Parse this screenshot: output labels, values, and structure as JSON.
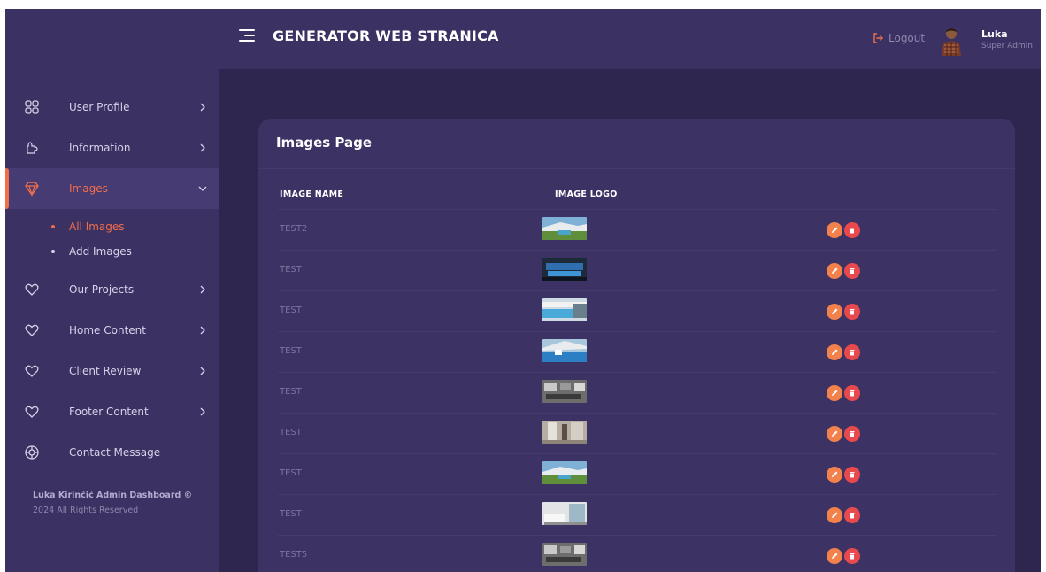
{
  "header": {
    "title": "GENERATOR WEB STRANICA",
    "logout_label": "Logout",
    "user_name": "Luka",
    "user_role": "Super Admin"
  },
  "sidebar": {
    "items": [
      {
        "label": "User Profile",
        "icon": "grid-icon",
        "has_caret": true
      },
      {
        "label": "Information",
        "icon": "puzzle-icon",
        "has_caret": true
      },
      {
        "label": "Images",
        "icon": "diamond-icon",
        "has_caret": true,
        "active": true,
        "expanded": true
      },
      {
        "label": "Our Projects",
        "icon": "heart-icon",
        "has_caret": true
      },
      {
        "label": "Home Content",
        "icon": "heart-icon",
        "has_caret": true
      },
      {
        "label": "Client Review",
        "icon": "heart-icon",
        "has_caret": true
      },
      {
        "label": "Footer Content",
        "icon": "heart-icon",
        "has_caret": true
      },
      {
        "label": "Contact Message",
        "icon": "life-ring-icon",
        "has_caret": false
      }
    ],
    "subitems": [
      {
        "label": "All Images",
        "active": true
      },
      {
        "label": "Add Images",
        "active": false
      }
    ],
    "footer_line1": "Luka Kirinčić Admin Dashboard ©",
    "footer_line2": "2024 All Rights Reserved"
  },
  "main": {
    "card_title": "Images Page",
    "columns": [
      "IMAGE NAME",
      "IMAGE LOGO"
    ],
    "rows": [
      {
        "name": "TEST2",
        "thumb": "house-pool-icon"
      },
      {
        "name": "TEST",
        "thumb": "night-pool-icon"
      },
      {
        "name": "TEST",
        "thumb": "pool-terrace-icon"
      },
      {
        "name": "TEST",
        "thumb": "pool-roof-icon"
      },
      {
        "name": "TEST",
        "thumb": "living-room-icon"
      },
      {
        "name": "TEST",
        "thumb": "interior-hall-icon"
      },
      {
        "name": "TEST",
        "thumb": "house-pool-icon"
      },
      {
        "name": "TEST",
        "thumb": "bedroom-icon"
      },
      {
        "name": "TEST5",
        "thumb": "living-room-icon"
      }
    ]
  },
  "colors": {
    "accent": "#f26e4b",
    "edit_button": "#f2814b",
    "delete_button": "#e8494c",
    "background": "#2f2650",
    "panel": "#3b3162",
    "card": "#3c3264"
  }
}
